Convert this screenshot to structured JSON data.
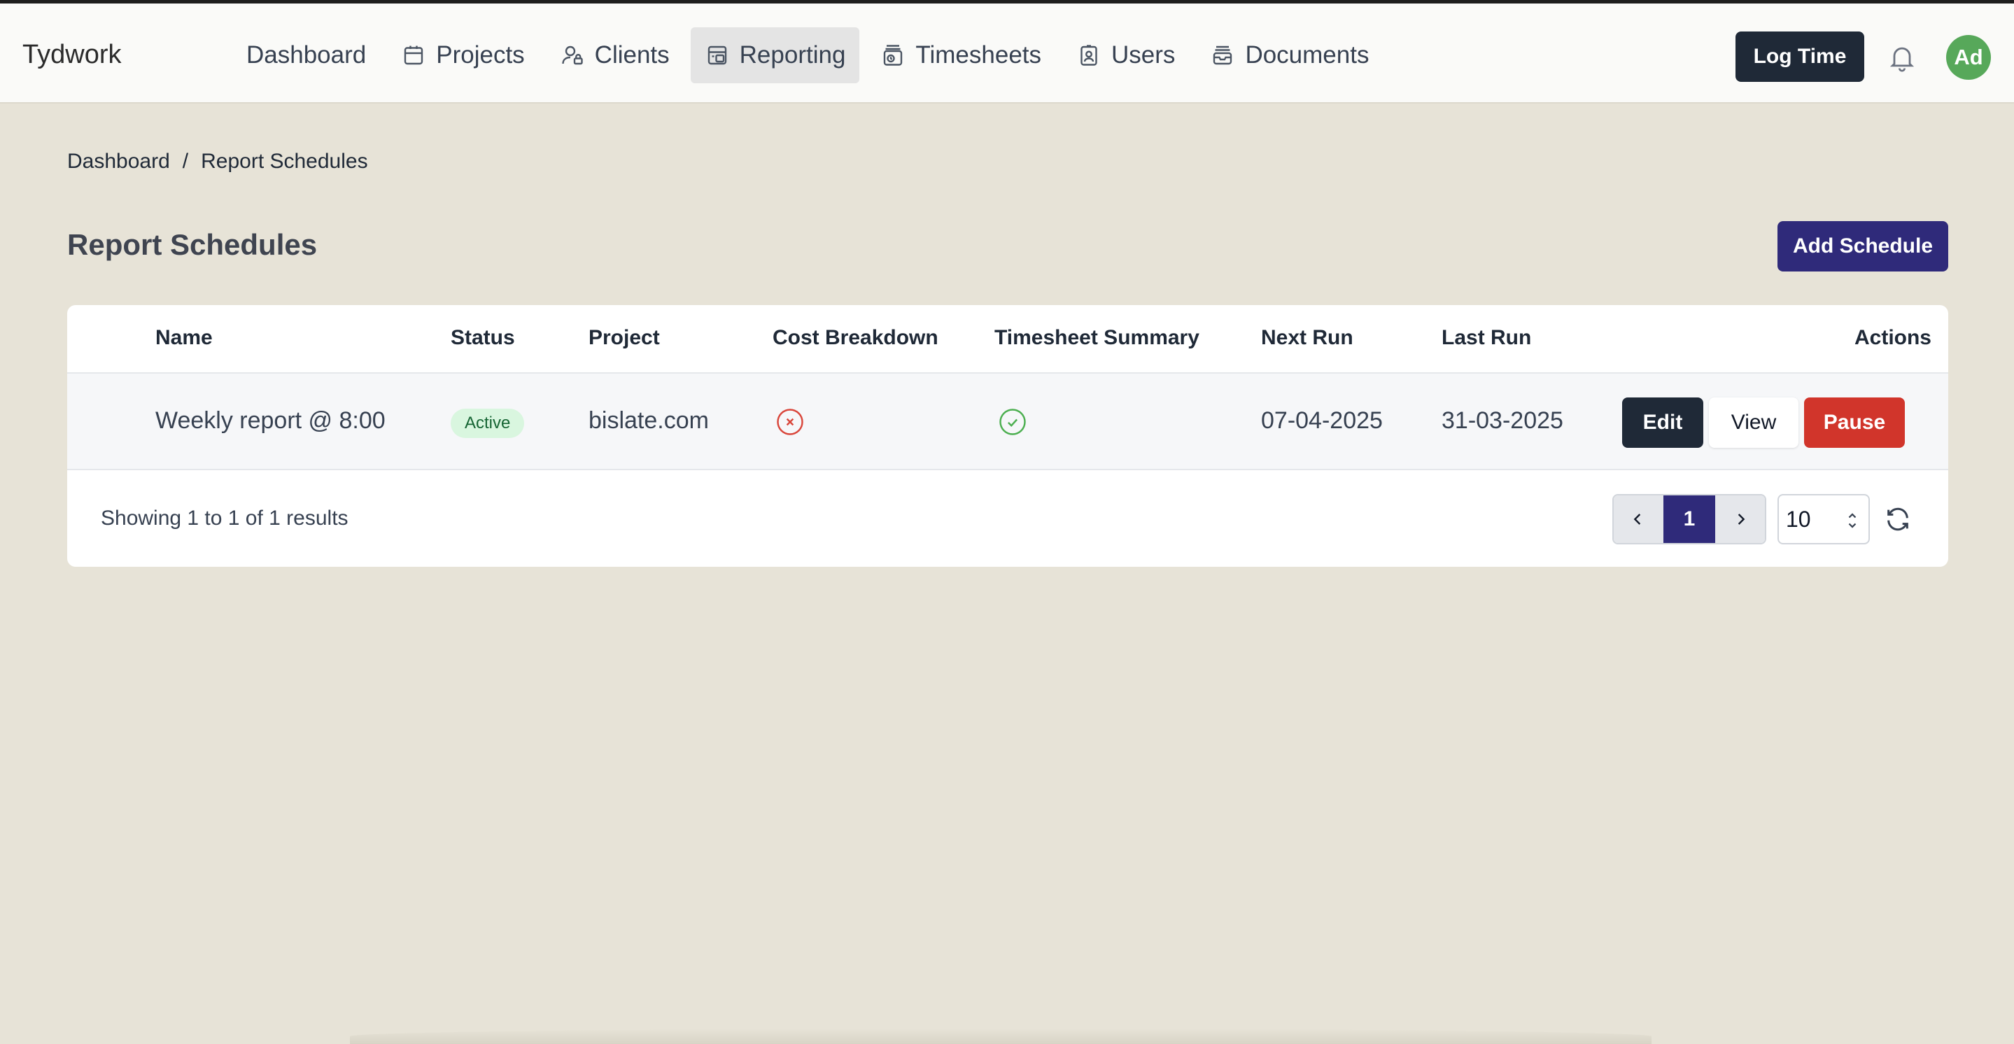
{
  "app": {
    "brand": "Tydwork"
  },
  "nav": {
    "items": [
      {
        "label": "Dashboard",
        "icon": "",
        "active": false
      },
      {
        "label": "Projects",
        "icon": "calendar-icon",
        "active": false
      },
      {
        "label": "Clients",
        "icon": "user-lock-icon",
        "active": false
      },
      {
        "label": "Reporting",
        "icon": "report-icon",
        "active": true
      },
      {
        "label": "Timesheets",
        "icon": "stack-clock-icon",
        "active": false
      },
      {
        "label": "Users",
        "icon": "id-badge-icon",
        "active": false
      },
      {
        "label": "Documents",
        "icon": "archive-icon",
        "active": false
      }
    ]
  },
  "header": {
    "log_time_label": "Log Time",
    "avatar_initials": "Ad",
    "avatar_color": "#57a85a"
  },
  "breadcrumb": {
    "home": "Dashboard",
    "separator": "/",
    "current": "Report Schedules"
  },
  "page": {
    "title": "Report Schedules",
    "add_label": "Add Schedule"
  },
  "table": {
    "columns": [
      "Name",
      "Status",
      "Project",
      "Cost Breakdown",
      "Timesheet Summary",
      "Next Run",
      "Last Run",
      "Actions"
    ],
    "rows": [
      {
        "name": "Weekly report @ 8:00",
        "status": "Active",
        "project": "bislate.com",
        "cost_breakdown": false,
        "timesheet_summary": true,
        "next_run": "07-04-2025",
        "last_run": "31-03-2025",
        "actions": {
          "edit": "Edit",
          "view": "View",
          "pause": "Pause"
        }
      }
    ]
  },
  "footer": {
    "showing_text": "Showing 1 to 1 of 1 results",
    "current_page": "1",
    "per_page": "10"
  },
  "colors": {
    "primary": "#2f2a7a",
    "danger": "#d1352b",
    "dark": "#1f2937",
    "success": "#4caf50",
    "error": "#d9463b"
  }
}
